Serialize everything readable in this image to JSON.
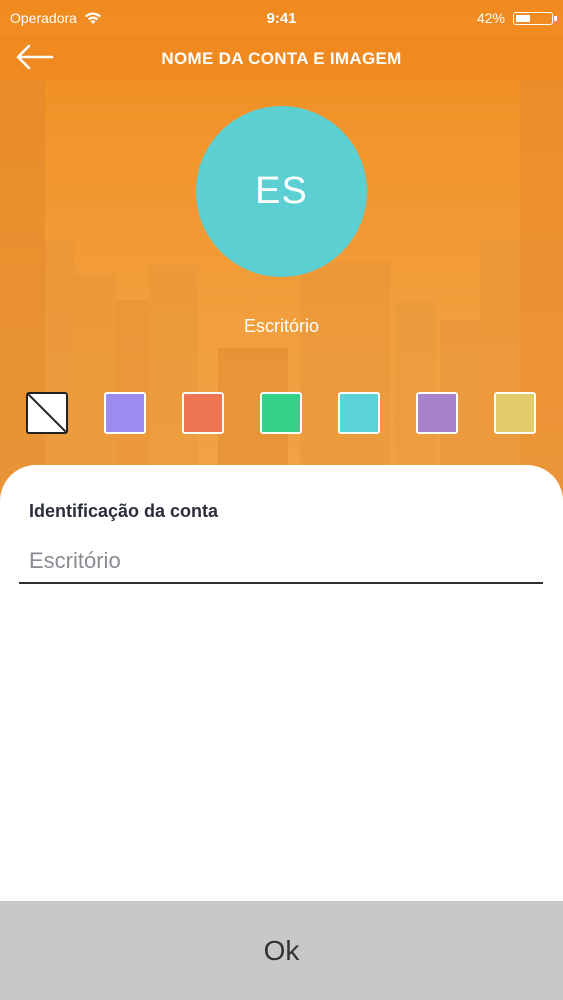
{
  "status_bar": {
    "carrier": "Operadora",
    "time": "9:41",
    "battery_percent": "42%",
    "battery_level": 0.42,
    "wifi_icon": "wifi-icon"
  },
  "nav": {
    "title": "NOME DA CONTA E IMAGEM",
    "back_icon": "arrow-left-icon"
  },
  "avatar": {
    "initials": "ES",
    "color": "#5ccfd3"
  },
  "account_name": "Escritório",
  "colors": {
    "header_orange": "#f0891f",
    "options": [
      {
        "name": "none",
        "hex": "#ffffff"
      },
      {
        "name": "lavender",
        "hex": "#9b8cf2"
      },
      {
        "name": "coral",
        "hex": "#ec7652"
      },
      {
        "name": "green",
        "hex": "#35d08a"
      },
      {
        "name": "teal",
        "hex": "#5bd3d6"
      },
      {
        "name": "purple",
        "hex": "#a783c9"
      },
      {
        "name": "yellow",
        "hex": "#e3cd6b"
      }
    ]
  },
  "form": {
    "label": "Identificação da conta",
    "placeholder": "Escritório",
    "value": ""
  },
  "ok_button": {
    "label": "Ok"
  }
}
